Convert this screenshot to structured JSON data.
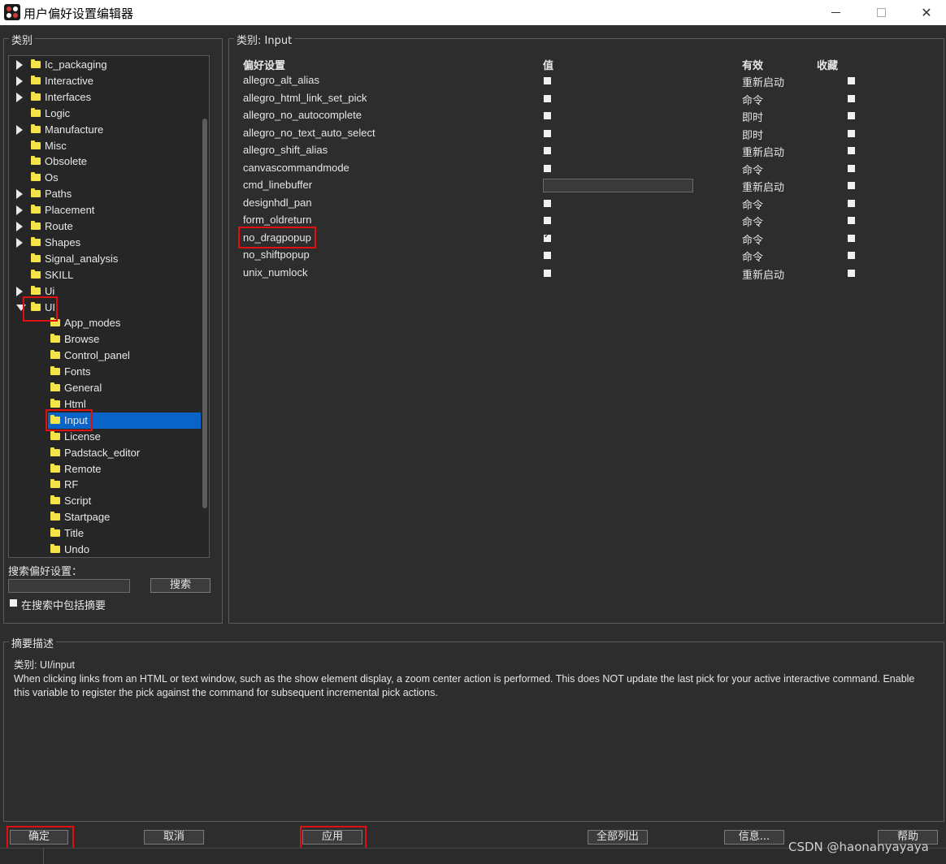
{
  "window": {
    "title": "用户偏好设置编辑器",
    "minimize_icon": "minimize-icon",
    "maximize_icon": "maximize-icon",
    "close_glyph": "✕"
  },
  "left_panel": {
    "title": "类别",
    "tree": [
      {
        "label": "Ic_packaging",
        "level": 0,
        "arrow": "right"
      },
      {
        "label": "Interactive",
        "level": 0,
        "arrow": "right"
      },
      {
        "label": "Interfaces",
        "level": 0,
        "arrow": "right"
      },
      {
        "label": "Logic",
        "level": 0,
        "arrow": "none"
      },
      {
        "label": "Manufacture",
        "level": 0,
        "arrow": "right"
      },
      {
        "label": "Misc",
        "level": 0,
        "arrow": "none"
      },
      {
        "label": "Obsolete",
        "level": 0,
        "arrow": "none"
      },
      {
        "label": "Os",
        "level": 0,
        "arrow": "none"
      },
      {
        "label": "Paths",
        "level": 0,
        "arrow": "right"
      },
      {
        "label": "Placement",
        "level": 0,
        "arrow": "right"
      },
      {
        "label": "Route",
        "level": 0,
        "arrow": "right"
      },
      {
        "label": "Shapes",
        "level": 0,
        "arrow": "right"
      },
      {
        "label": "Signal_analysis",
        "level": 0,
        "arrow": "none"
      },
      {
        "label": "SKILL",
        "level": 0,
        "arrow": "none"
      },
      {
        "label": "Ui",
        "level": 0,
        "arrow": "right"
      },
      {
        "label": "UI",
        "level": 0,
        "arrow": "down"
      },
      {
        "label": "App_modes",
        "level": 1,
        "arrow": "none"
      },
      {
        "label": "Browse",
        "level": 1,
        "arrow": "none"
      },
      {
        "label": "Control_panel",
        "level": 1,
        "arrow": "none"
      },
      {
        "label": "Fonts",
        "level": 1,
        "arrow": "none"
      },
      {
        "label": "General",
        "level": 1,
        "arrow": "none"
      },
      {
        "label": "Html",
        "level": 1,
        "arrow": "none"
      },
      {
        "label": "Input",
        "level": 1,
        "arrow": "none",
        "selected": true
      },
      {
        "label": "License",
        "level": 1,
        "arrow": "none"
      },
      {
        "label": "Padstack_editor",
        "level": 1,
        "arrow": "none"
      },
      {
        "label": "Remote",
        "level": 1,
        "arrow": "none"
      },
      {
        "label": "RF",
        "level": 1,
        "arrow": "none"
      },
      {
        "label": "Script",
        "level": 1,
        "arrow": "none"
      },
      {
        "label": "Startpage",
        "level": 1,
        "arrow": "none"
      },
      {
        "label": "Title",
        "level": 1,
        "arrow": "none"
      },
      {
        "label": "Undo",
        "level": 1,
        "arrow": "none"
      }
    ],
    "search_label": "搜索偏好设置：",
    "search_value": "",
    "search_button": "搜索",
    "include_summary_label": "在搜索中包括摘要"
  },
  "right_panel": {
    "title": "类别:  Input",
    "headers": {
      "name": "偏好设置",
      "value": "值",
      "effective": "有效",
      "favorite": "收藏"
    },
    "rows": [
      {
        "name": "allegro_alt_alias",
        "value_type": "checkbox",
        "checked": false,
        "effective": "重新启动"
      },
      {
        "name": "allegro_html_link_set_pick",
        "value_type": "checkbox",
        "checked": false,
        "effective": "命令"
      },
      {
        "name": "allegro_no_autocomplete",
        "value_type": "checkbox",
        "checked": false,
        "effective": "即时"
      },
      {
        "name": "allegro_no_text_auto_select",
        "value_type": "checkbox",
        "checked": false,
        "effective": "即时"
      },
      {
        "name": "allegro_shift_alias",
        "value_type": "checkbox",
        "checked": false,
        "effective": "重新启动"
      },
      {
        "name": "canvascommandmode",
        "value_type": "checkbox",
        "checked": false,
        "effective": "命令"
      },
      {
        "name": "cmd_linebuffer",
        "value_type": "text",
        "checked": false,
        "effective": "重新启动"
      },
      {
        "name": "designhdl_pan",
        "value_type": "checkbox",
        "checked": false,
        "effective": "命令"
      },
      {
        "name": "form_oldreturn",
        "value_type": "checkbox",
        "checked": false,
        "effective": "命令"
      },
      {
        "name": "no_dragpopup",
        "value_type": "checkbox",
        "checked": true,
        "effective": "命令"
      },
      {
        "name": "no_shiftpopup",
        "value_type": "checkbox",
        "checked": false,
        "effective": "命令"
      },
      {
        "name": "unix_numlock",
        "value_type": "checkbox",
        "checked": false,
        "effective": "重新启动"
      }
    ]
  },
  "summary": {
    "title": "摘要描述",
    "category_line": "类别: UI/input",
    "description": "When clicking links from an HTML or text window, such as the show element display, a zoom center action is performed. This does NOT update the last pick for your active interactive command. Enable this variable to register the pick against the command for subsequent incremental pick actions."
  },
  "buttons": {
    "ok": "确定",
    "cancel": "取消",
    "apply": "应用",
    "list_all": "全部列出",
    "info": "信息...",
    "help": "帮助"
  },
  "watermark": "CSDN @haonanyayaya",
  "annotation_color": "#e01010",
  "selection_color": "#0a64c8"
}
